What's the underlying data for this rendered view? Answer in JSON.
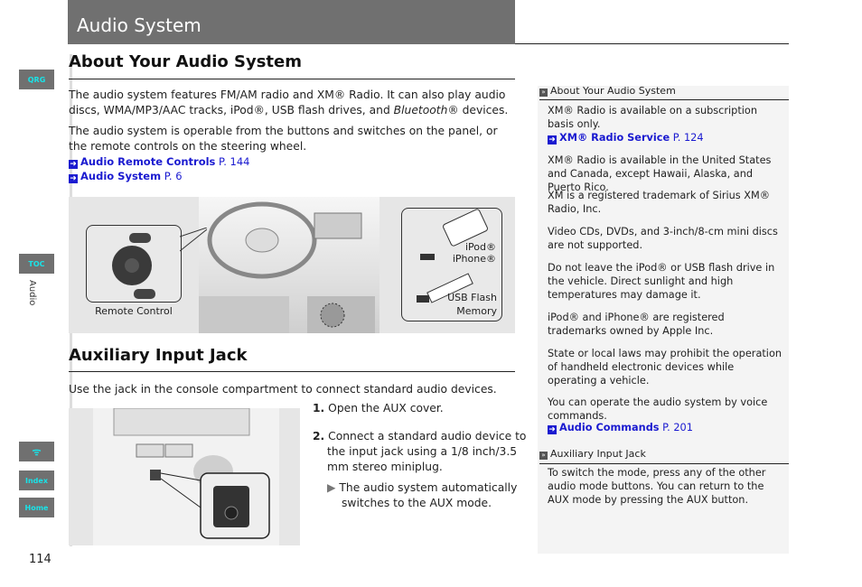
{
  "header": {
    "title": "Audio System"
  },
  "side_tabs": {
    "qrg": "QRG",
    "toc": "TOC",
    "section_label": "Audio",
    "voice_icon": "voice-command-icon",
    "index": "Index",
    "home": "Home"
  },
  "page_number": "114",
  "about": {
    "heading": "About Your Audio System",
    "para1_a": "The audio system features FM/AM radio and XM® Radio. It can also play audio discs, WMA/MP3/AAC tracks, iPod®, USB flash drives, and ",
    "para1_italic": "Bluetooth",
    "para1_b": "® devices.",
    "para2": "The audio system is operable from the buttons and switches on the panel, or the remote controls on the steering wheel.",
    "links": [
      {
        "label": "Audio Remote Controls",
        "page": "P. 144"
      },
      {
        "label": "Audio System",
        "page": "P. 6"
      }
    ],
    "figure": {
      "remote_caption": "Remote Control",
      "ipod_caption_1": "iPod®",
      "ipod_caption_2": "iPhone®",
      "usb_caption_1": "USB Flash",
      "usb_caption_2": "Memory"
    }
  },
  "aux": {
    "heading": "Auxiliary Input Jack",
    "intro": "Use the jack in the console compartment to connect standard audio devices.",
    "steps": [
      {
        "num": "1.",
        "text": "Open the AUX cover."
      },
      {
        "num": "2.",
        "text": "Connect a standard audio device to the input jack using a 1/8 inch/3.5 mm stereo miniplug."
      }
    ],
    "result": "The audio system automatically switches to the AUX mode."
  },
  "notes": {
    "about_head": "About Your Audio System",
    "about_items": [
      "XM® Radio is available on a subscription basis only.",
      "XM® Radio is available in the United States and Canada, except Hawaii, Alaska, and Puerto Rico.",
      "XM is a registered trademark of Sirius XM® Radio, Inc.",
      "Video CDs, DVDs, and 3-inch/8-cm mini discs are not supported.",
      "Do not leave the iPod® or USB flash drive in the vehicle. Direct sunlight and high temperatures may damage it.",
      "iPod® and iPhone® are registered trademarks owned by Apple Inc.",
      "State or local laws may prohibit the operation of handheld electronic devices while operating a vehicle.",
      "You can operate the audio system by voice commands."
    ],
    "xm_link": {
      "label": "XM® Radio Service",
      "page": "P. 124"
    },
    "cmd_link": {
      "label": "Audio Commands",
      "page": "P. 201"
    },
    "aux_head": "Auxiliary Input Jack",
    "aux_text": "To switch the mode, press any of the other audio mode buttons. You can return to the AUX mode by pressing the AUX button."
  },
  "colors": {
    "link": "#1a1ad0",
    "tab_bg": "#707070",
    "tab_text": "#19e3e8"
  }
}
